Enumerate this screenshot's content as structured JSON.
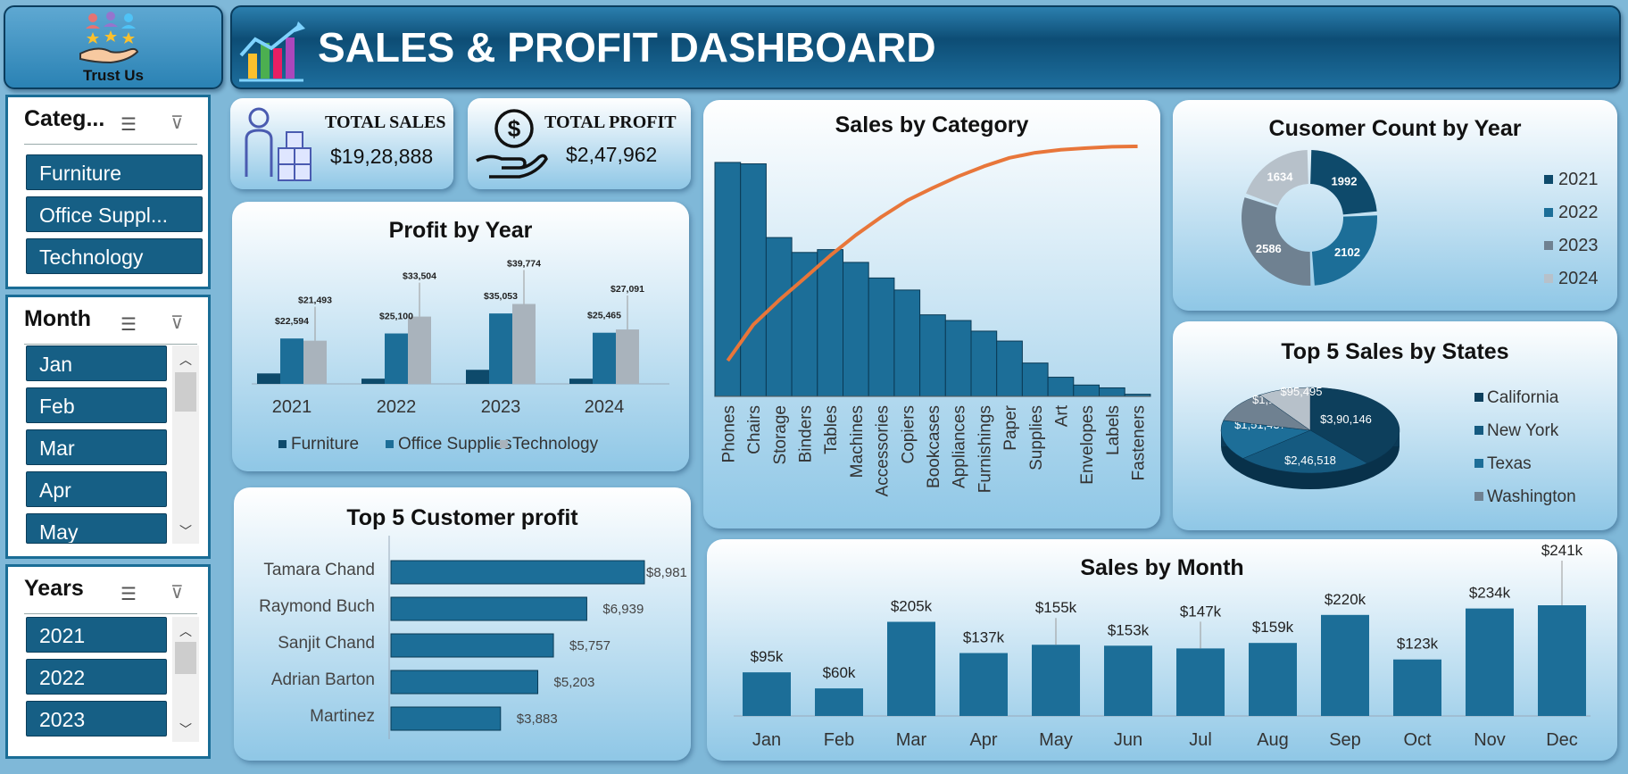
{
  "logo": {
    "caption": "Trust Us"
  },
  "header": {
    "title": "SALES & PROFIT DASHBOARD"
  },
  "colors": {
    "dark": "#0e4a6b",
    "mid": "#1c6e98",
    "grey": "#a9b3bc",
    "light": "#c8ced4",
    "orange": "#e8763a"
  },
  "slicers": {
    "category": {
      "title": "Categ...",
      "items": [
        "Furniture",
        "Office Suppl...",
        "Technology"
      ]
    },
    "month": {
      "title": "Month",
      "items": [
        "Jan",
        "Feb",
        "Mar",
        "Apr",
        "May"
      ]
    },
    "years": {
      "title": "Years",
      "items": [
        "2021",
        "2022",
        "2023"
      ]
    }
  },
  "kpis": {
    "sales": {
      "label": "TOTAL SALES",
      "value": "$19,28,888"
    },
    "profit": {
      "label": "TOTAL PROFIT",
      "value": "$2,47,962"
    }
  },
  "chart_data": [
    {
      "id": "profit_by_year",
      "type": "bar",
      "title": "Profit by Year",
      "categories": [
        "2021",
        "2022",
        "2023",
        "2024"
      ],
      "series": [
        {
          "name": "Furniture",
          "values": [
            5200,
            2600,
            7000,
            2600
          ]
        },
        {
          "name": "Office Supplies",
          "values": [
            22594,
            25100,
            35053,
            25465
          ]
        },
        {
          "name": "Technology",
          "values": [
            21493,
            33504,
            39774,
            27091
          ]
        }
      ],
      "labels": {
        "Office Supplies": [
          "$22,594",
          "$25,100",
          "$35,053",
          "$25,465"
        ],
        "Technology": [
          "$21,493",
          "$33,504",
          "$39,774",
          "$27,091"
        ]
      },
      "legend": "bottom"
    },
    {
      "id": "sales_by_category",
      "type": "bar",
      "title": "Sales by Category",
      "categories": [
        "Phones",
        "Chairs",
        "Storage",
        "Binders",
        "Tables",
        "Machines",
        "Accessories",
        "Copiers",
        "Bookcases",
        "Appliances",
        "Furnishings",
        "Paper",
        "Supplies",
        "Art",
        "Envelopes",
        "Labels",
        "Fasteners"
      ],
      "values": [
        330000,
        328000,
        224000,
        203000,
        207000,
        189000,
        167000,
        150000,
        115000,
        107000,
        92000,
        78000,
        47000,
        27000,
        16000,
        12000,
        3000
      ],
      "pareto_line": true
    },
    {
      "id": "customer_count_by_year",
      "type": "pie",
      "title": "Cusomer Count by Year",
      "categories": [
        "2021",
        "2022",
        "2023",
        "2024"
      ],
      "values": [
        1992,
        2102,
        2586,
        1634
      ],
      "donut": true,
      "legend": "right"
    },
    {
      "id": "top5_sales_by_states",
      "type": "pie",
      "title": "Top 5 Sales by States",
      "categories": [
        "California",
        "New York",
        "Texas",
        "Washington",
        ""
      ],
      "values": [
        390146,
        246518,
        151437,
        117661,
        95495
      ],
      "labels": [
        "$3,90,146",
        "$2,46,518",
        "$1,51,437",
        "$1,17,661",
        "$95,495"
      ],
      "legend": "right"
    },
    {
      "id": "top5_customer_profit",
      "type": "bar",
      "orientation": "horizontal",
      "title": "Top 5 Customer profit",
      "categories": [
        "Tamara Chand",
        "Raymond Buch",
        "Sanjit Chand",
        "Adrian Barton",
        "Martinez"
      ],
      "values": [
        8981,
        6939,
        5757,
        5203,
        3883
      ],
      "labels": [
        "$8,981",
        "$6,939",
        "$5,757",
        "$5,203",
        "$3,883"
      ]
    },
    {
      "id": "sales_by_month",
      "type": "bar",
      "title": "Sales by Month",
      "categories": [
        "Jan",
        "Feb",
        "Mar",
        "Apr",
        "May",
        "Jun",
        "Jul",
        "Aug",
        "Sep",
        "Oct",
        "Nov",
        "Dec"
      ],
      "values": [
        95,
        60,
        205,
        137,
        155,
        153,
        147,
        159,
        220,
        123,
        234,
        241
      ],
      "labels": [
        "$95k",
        "$60k",
        "$205k",
        "$137k",
        "$155k",
        "$153k",
        "$147k",
        "$159k",
        "$220k",
        "$123k",
        "$234k",
        "$241k"
      ]
    }
  ]
}
